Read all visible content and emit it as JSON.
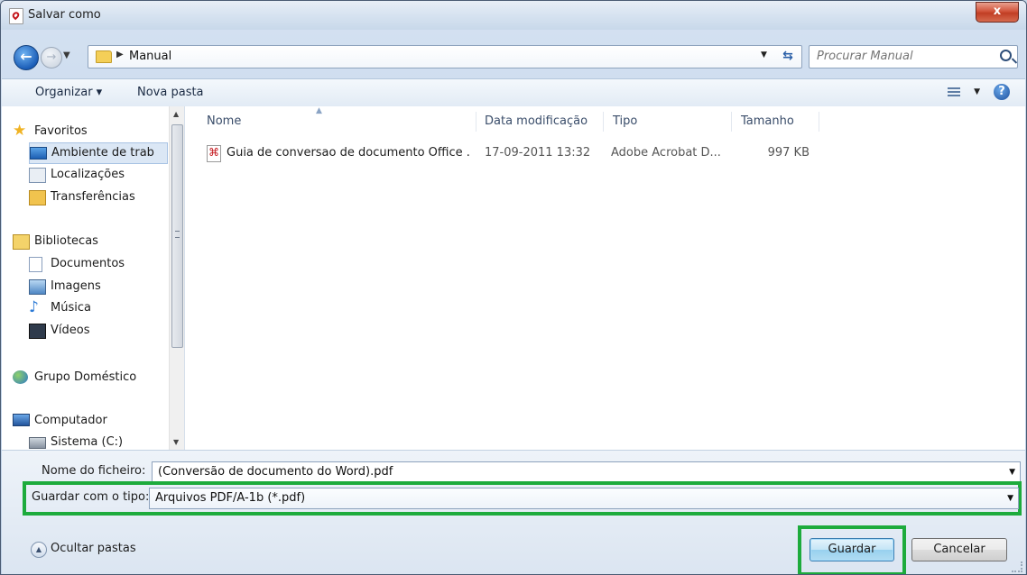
{
  "window": {
    "title": "Salvar como",
    "close_label": "x"
  },
  "address": {
    "path_item": "Manual",
    "search_placeholder": "Procurar Manual"
  },
  "toolbar": {
    "organize_label": "Organizar ▾",
    "new_folder_label": "Nova pasta"
  },
  "sidebar": {
    "items": [
      {
        "label": "Favoritos",
        "icon": "star-icon"
      },
      {
        "label": "Ambiente de trab",
        "icon": "desktop-icon"
      },
      {
        "label": "Localizações",
        "icon": "places-icon"
      },
      {
        "label": "Transferências",
        "icon": "downloads-icon"
      },
      {
        "label": "Bibliotecas",
        "icon": "libraries-icon"
      },
      {
        "label": "Documentos",
        "icon": "documents-icon"
      },
      {
        "label": "Imagens",
        "icon": "pictures-icon"
      },
      {
        "label": "Música",
        "icon": "music-icon"
      },
      {
        "label": "Vídeos",
        "icon": "videos-icon"
      },
      {
        "label": "Grupo Doméstico",
        "icon": "homegroup-icon"
      },
      {
        "label": "Computador",
        "icon": "computer-icon"
      },
      {
        "label": "Sistema (C:)",
        "icon": "drive-icon"
      }
    ]
  },
  "files": {
    "columns": [
      "Nome",
      "Data modificação",
      "Tipo",
      "Tamanho"
    ],
    "rows": [
      {
        "name": "Guia de conversao de documento Office ...",
        "date": "17-09-2011 13:32",
        "type": "Adobe Acrobat D...",
        "size": "997 KB",
        "icon": "pdf-icon"
      }
    ]
  },
  "form": {
    "filename_label": "Nome do ficheiro:",
    "filename_value": "(Conversão de documento do Word).pdf",
    "filetype_label": "Guardar com o tipo:",
    "filetype_value": "Arquivos PDF/A-1b (*.pdf)"
  },
  "footer": {
    "hide_folders_label": "Ocultar pastas",
    "save_label": "Guardar",
    "cancel_label": "Cancelar"
  },
  "colors": {
    "highlight": "#1dab3c",
    "pdf_red": "#c4161c",
    "accent": "#1c5eb8"
  }
}
